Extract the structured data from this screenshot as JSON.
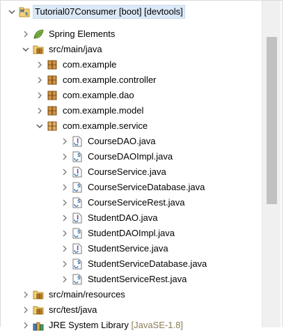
{
  "tree": {
    "project": {
      "name": "Tutorial07Consumer",
      "suffix": " [boot] [devtools]",
      "icon": "maven-project-icon"
    },
    "spring_elements": {
      "label": "Spring Elements",
      "icon": "spring-leaf-icon"
    },
    "src_main_java": {
      "label": "src/main/java",
      "icon": "source-folder-icon"
    },
    "packages": [
      {
        "label": "com.example",
        "icon": "package-icon"
      },
      {
        "label": "com.example.controller",
        "icon": "package-icon"
      },
      {
        "label": "com.example.dao",
        "icon": "package-icon"
      },
      {
        "label": "com.example.model",
        "icon": "package-icon"
      },
      {
        "label": "com.example.service",
        "icon": "package-icon"
      }
    ],
    "service_files": [
      {
        "label": "CourseDAO.java",
        "icon": "java-interface-icon"
      },
      {
        "label": "CourseDAOImpl.java",
        "icon": "java-class-icon"
      },
      {
        "label": "CourseService.java",
        "icon": "java-interface-icon"
      },
      {
        "label": "CourseServiceDatabase.java",
        "icon": "java-class-icon"
      },
      {
        "label": "CourseServiceRest.java",
        "icon": "java-class-icon"
      },
      {
        "label": "StudentDAO.java",
        "icon": "java-interface-icon"
      },
      {
        "label": "StudentDAOImpl.java",
        "icon": "java-class-icon"
      },
      {
        "label": "StudentService.java",
        "icon": "java-interface-icon"
      },
      {
        "label": "StudentServiceDatabase.java",
        "icon": "java-class-icon"
      },
      {
        "label": "StudentServiceRest.java",
        "icon": "java-class-icon"
      }
    ],
    "src_main_resources": {
      "label": "src/main/resources",
      "icon": "source-folder-icon"
    },
    "src_test_java": {
      "label": "src/test/java",
      "icon": "source-folder-icon"
    },
    "jre": {
      "label": "JRE System Library",
      "decoration": " [JavaSE-1.8]",
      "icon": "library-icon"
    }
  },
  "colors": {
    "selection": "#dbe8f6",
    "decoration_text": "#8b7b57",
    "package_brown": "#9a6b2f",
    "interface_purple": "#6a4fa0",
    "class_blue": "#2f6fb0"
  }
}
